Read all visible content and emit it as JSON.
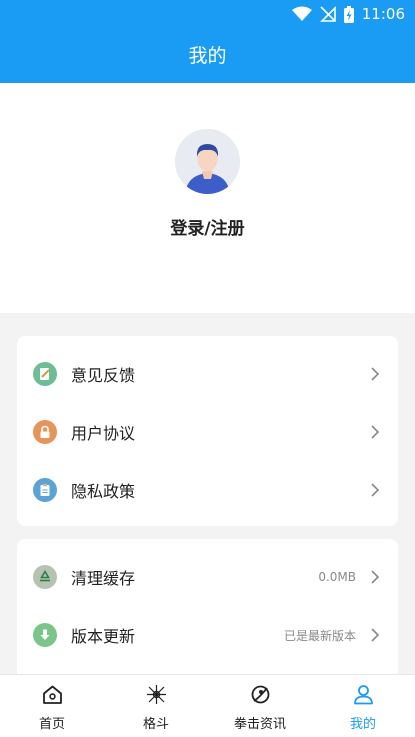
{
  "status_bar": {
    "time": "11:06"
  },
  "header": {
    "title": "我的"
  },
  "profile": {
    "login_label": "登录/注册"
  },
  "menu_group1": [
    {
      "label": "意见反馈",
      "icon": "feedback-icon",
      "color": "#6dbd96"
    },
    {
      "label": "用户协议",
      "icon": "lock-icon",
      "color": "#e6955a"
    },
    {
      "label": "隐私政策",
      "icon": "clipboard-icon",
      "color": "#5aa3d6"
    }
  ],
  "menu_group2": [
    {
      "label": "清理缓存",
      "value": "0.0MB",
      "icon": "recycle-icon",
      "color": "#b8c2b0"
    },
    {
      "label": "版本更新",
      "value": "已是最新版本",
      "icon": "download-icon",
      "color": "#7cc58a"
    }
  ],
  "tabbar": {
    "tabs": [
      {
        "label": "首页",
        "icon": "home-icon"
      },
      {
        "label": "格斗",
        "icon": "fight-icon"
      },
      {
        "label": "拳击资讯",
        "icon": "news-icon"
      },
      {
        "label": "我的",
        "icon": "profile-icon",
        "active": true
      }
    ]
  },
  "colors": {
    "accent": "#1a9cf4",
    "background": "#f3f3f3"
  }
}
